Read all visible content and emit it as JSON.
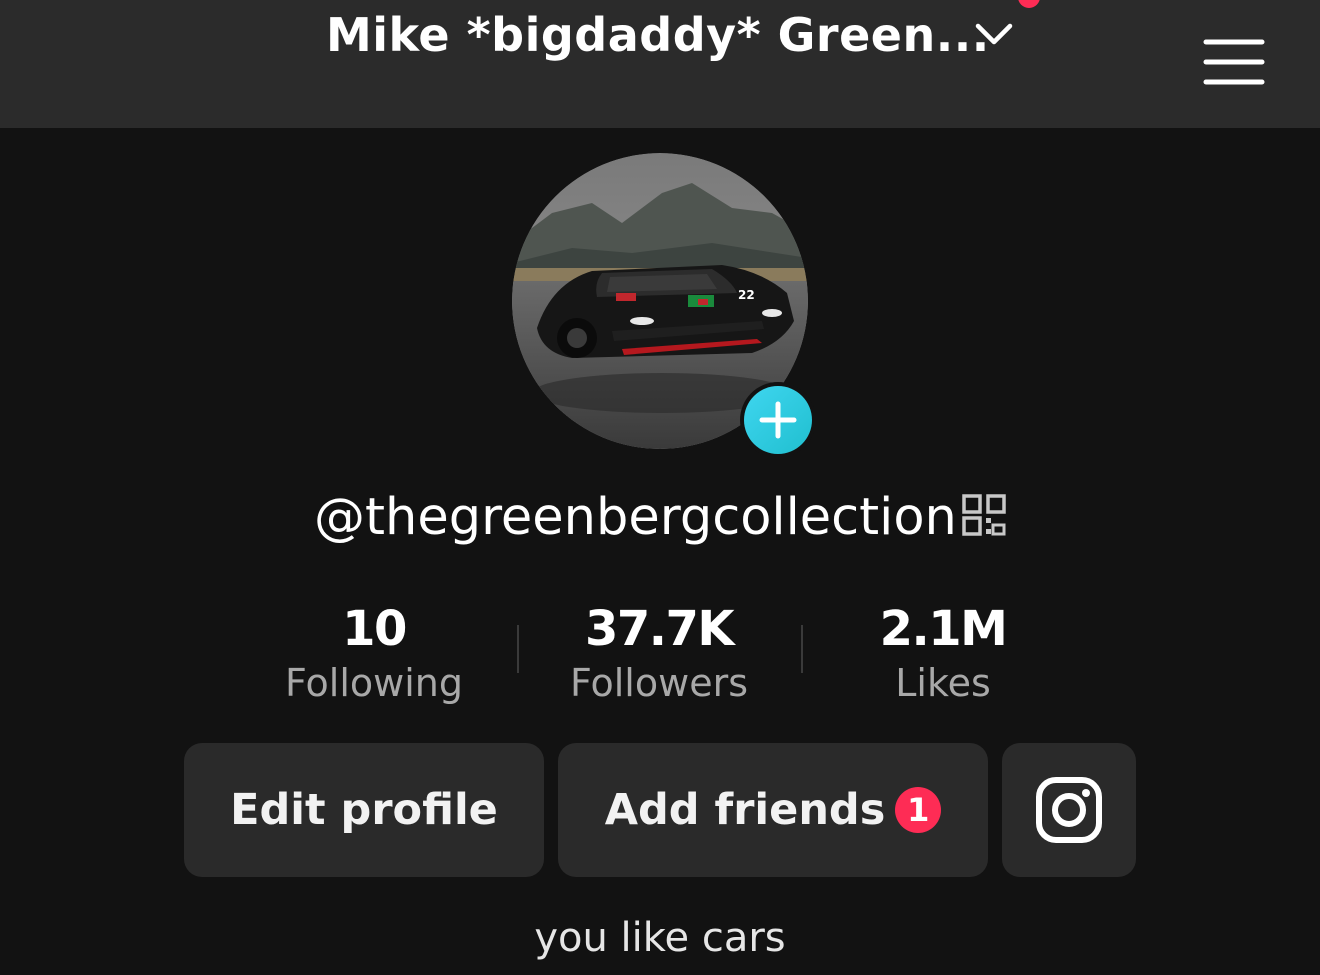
{
  "header": {
    "title": "Mike *bigdaddy* Green...",
    "chevron_icon": "chevron-down-icon",
    "menu_icon": "hamburger-menu-icon",
    "notification_color": "#fe2c55"
  },
  "profile": {
    "avatar_icon": "sports-car-photo",
    "add_icon": "plus-icon",
    "username": "@thegreenbergcollection",
    "qr_icon": "qr-code-icon",
    "bio": "you like cars"
  },
  "stats": [
    {
      "value": "10",
      "label": "Following"
    },
    {
      "value": "37.7K",
      "label": "Followers"
    },
    {
      "value": "2.1M",
      "label": "Likes"
    }
  ],
  "actions": {
    "edit_profile": "Edit profile",
    "add_friends": "Add friends",
    "add_friends_badge": "1",
    "instagram_icon": "instagram-icon"
  },
  "colors": {
    "background": "#121212",
    "header_bg": "#2b2b2b",
    "button_bg": "#2a2a2a",
    "accent_red": "#fe2c55",
    "accent_cyan": "#20bfcf"
  }
}
